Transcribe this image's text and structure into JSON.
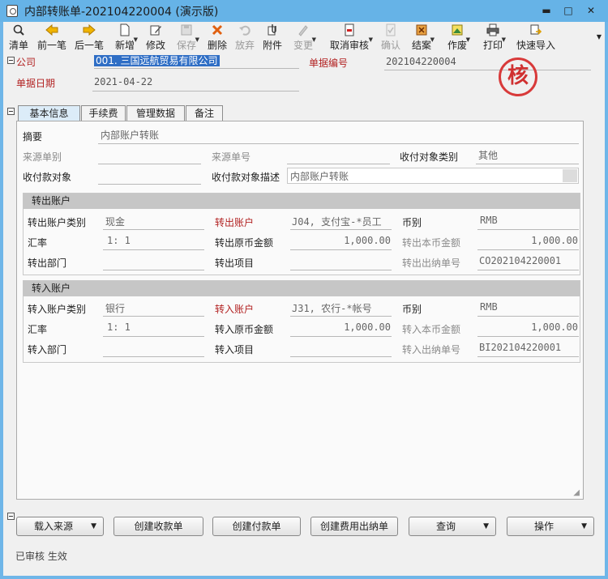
{
  "window": {
    "title": "内部转账单-202104220004 (演示版)",
    "minimize": "▬",
    "maximize": "□",
    "close": "✕"
  },
  "toolbar": [
    {
      "label": "清单",
      "icon": "list-search-icon",
      "enabled": true,
      "dropdown": false
    },
    {
      "label": "前一笔",
      "icon": "arrow-left-icon",
      "enabled": true,
      "dropdown": false
    },
    {
      "label": "后一笔",
      "icon": "arrow-right-icon",
      "enabled": true,
      "dropdown": false
    },
    {
      "label": "新增",
      "icon": "new-document-icon",
      "enabled": true,
      "dropdown": true
    },
    {
      "label": "修改",
      "icon": "edit-icon",
      "enabled": true,
      "dropdown": false
    },
    {
      "label": "保存",
      "icon": "save-icon",
      "enabled": false,
      "dropdown": true
    },
    {
      "label": "删除",
      "icon": "delete-x-icon",
      "enabled": true,
      "dropdown": false
    },
    {
      "label": "放弃",
      "icon": "undo-icon",
      "enabled": false,
      "dropdown": false
    },
    {
      "label": "附件",
      "icon": "attachment-icon",
      "enabled": true,
      "dropdown": false
    },
    {
      "label": "变更",
      "icon": "change-icon",
      "enabled": false,
      "dropdown": true
    },
    {
      "label": "取消审核",
      "icon": "cancel-audit-icon",
      "enabled": true,
      "dropdown": true
    },
    {
      "label": "确认",
      "icon": "confirm-icon",
      "enabled": false,
      "dropdown": false
    },
    {
      "label": "结案",
      "icon": "close-case-icon",
      "enabled": true,
      "dropdown": true
    },
    {
      "label": "作废",
      "icon": "void-icon",
      "enabled": true,
      "dropdown": true
    },
    {
      "label": "打印",
      "icon": "printer-icon",
      "enabled": true,
      "dropdown": true
    },
    {
      "label": "快速导入",
      "icon": "quick-import-icon",
      "enabled": true,
      "dropdown": false
    }
  ],
  "header": {
    "company_label": "公司",
    "company_value": "001. 三国远航贸易有限公司",
    "doc_no_label": "单据编号",
    "doc_no_value": "202104220004",
    "doc_date_label": "单据日期",
    "doc_date_value": "2021-04-22",
    "stamp_text": "核"
  },
  "tabs": [
    {
      "label": "基本信息",
      "active": true
    },
    {
      "label": "手续费",
      "active": false
    },
    {
      "label": "管理数据",
      "active": false
    },
    {
      "label": "备注",
      "active": false
    }
  ],
  "basic": {
    "summary_label": "摘要",
    "summary_value": "内部账户转账",
    "source_doc_type_label": "来源单别",
    "source_doc_type_value": "",
    "source_doc_no_label": "来源单号",
    "source_doc_no_value": "",
    "payee_type_label": "收付对象类别",
    "payee_type_value": "其他",
    "payee_label": "收付款对象",
    "payee_value": "",
    "payee_desc_label": "收付款对象描述",
    "payee_desc_value": "内部账户转账"
  },
  "out_account": {
    "title": "转出账户",
    "type_label": "转出账户类别",
    "type_value": "现金",
    "account_label": "转出账户",
    "account_value": "J04, 支付宝-*员工",
    "currency_label": "币别",
    "currency_value": "RMB",
    "rate_label": "汇率",
    "rate_value": "1: 1",
    "orig_amount_label": "转出原币金额",
    "orig_amount_value": "1,000.00",
    "local_amount_label": "转出本币金额",
    "local_amount_value": "1,000.00",
    "dept_label": "转出部门",
    "dept_value": "",
    "project_label": "转出项目",
    "project_value": "",
    "cashier_no_label": "转出出纳单号",
    "cashier_no_value": "CO202104220001"
  },
  "in_account": {
    "title": "转入账户",
    "type_label": "转入账户类别",
    "type_value": "银行",
    "account_label": "转入账户",
    "account_value": "J31, 农行-*帐号",
    "currency_label": "币别",
    "currency_value": "RMB",
    "rate_label": "汇率",
    "rate_value": "1: 1",
    "orig_amount_label": "转入原币金额",
    "orig_amount_value": "1,000.00",
    "local_amount_label": "转入本币金额",
    "local_amount_value": "1,000.00",
    "dept_label": "转入部门",
    "dept_value": "",
    "project_label": "转入项目",
    "project_value": "",
    "cashier_no_label": "转入出纳单号",
    "cashier_no_value": "BI202104220001"
  },
  "buttons": {
    "load_source": "载入来源",
    "create_receipt": "创建收款单",
    "create_payment": "创建付款单",
    "create_fee_cashier": "创建费用出纳单",
    "query": "查询",
    "operate": "操作"
  },
  "status": "已审核 生效",
  "colors": {
    "title_bar": "#66b3e7",
    "required_label": "#b22222",
    "selection": "#2f6ec5",
    "stamp": "#d83a3a"
  }
}
